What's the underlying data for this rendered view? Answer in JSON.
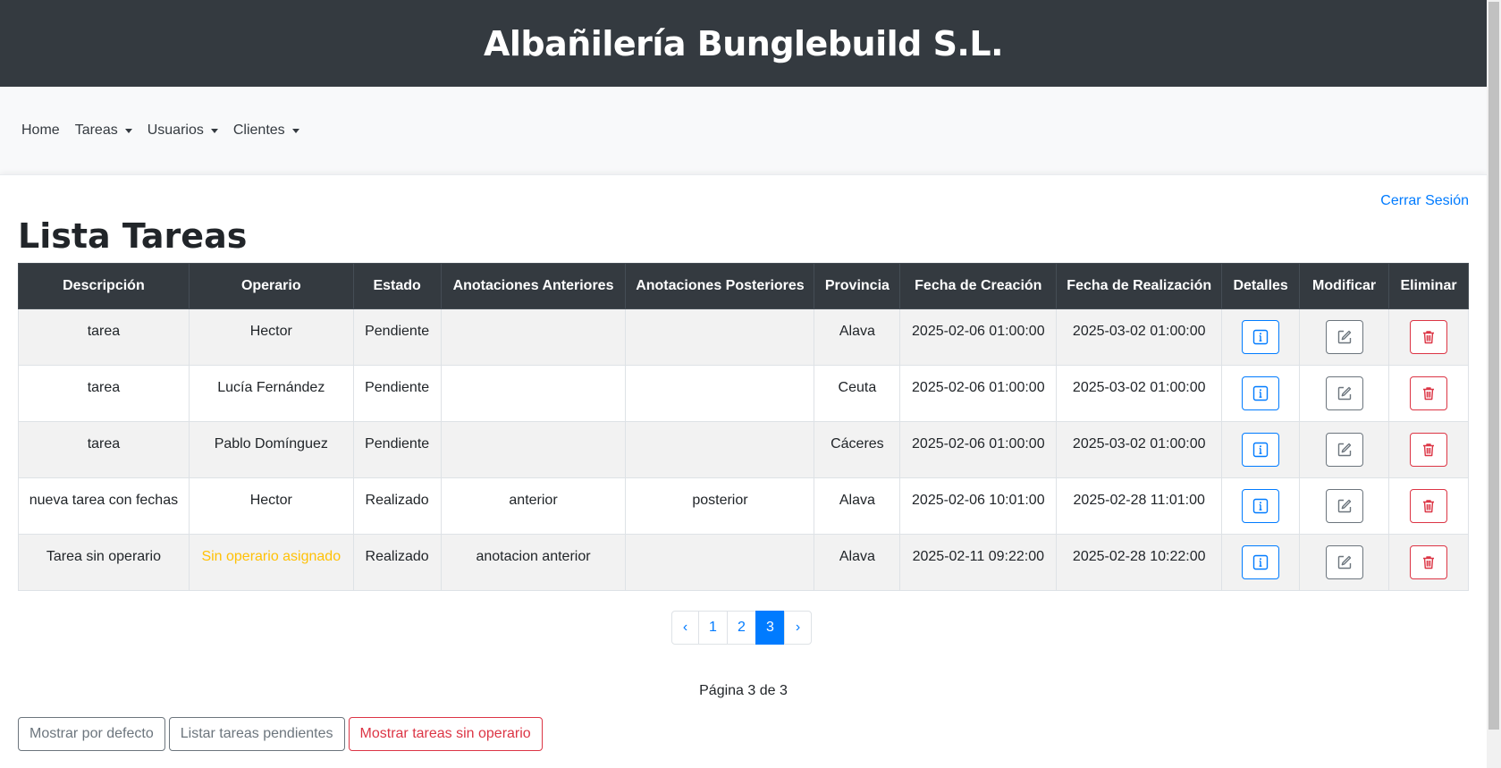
{
  "header": {
    "title": "Albañilería Bunglebuild S.L."
  },
  "nav": [
    {
      "label": "Home",
      "dropdown": false
    },
    {
      "label": "Tareas",
      "dropdown": true
    },
    {
      "label": "Usuarios",
      "dropdown": true
    },
    {
      "label": "Clientes",
      "dropdown": true
    }
  ],
  "logout": "Cerrar Sesión",
  "page_title": "Lista Tareas",
  "table": {
    "headers": [
      "Descripción",
      "Operario",
      "Estado",
      "Anotaciones Anteriores",
      "Anotaciones Posteriores",
      "Provincia",
      "Fecha de Creación",
      "Fecha de Realización",
      "Detalles",
      "Modificar",
      "Eliminar"
    ],
    "rows": [
      {
        "descripcion": "tarea",
        "operario": "Hector",
        "estado": "Pendiente",
        "anteriores": "",
        "posteriores": "",
        "provincia": "Alava",
        "creacion": "2025-02-06 01:00:00",
        "realizacion": "2025-03-02 01:00:00"
      },
      {
        "descripcion": "tarea",
        "operario": "Lucía Fernández",
        "estado": "Pendiente",
        "anteriores": "",
        "posteriores": "",
        "provincia": "Ceuta",
        "creacion": "2025-02-06 01:00:00",
        "realizacion": "2025-03-02 01:00:00"
      },
      {
        "descripcion": "tarea",
        "operario": "Pablo Domínguez",
        "estado": "Pendiente",
        "anteriores": "",
        "posteriores": "",
        "provincia": "Cáceres",
        "creacion": "2025-02-06 01:00:00",
        "realizacion": "2025-03-02 01:00:00"
      },
      {
        "descripcion": "nueva tarea con fechas",
        "operario": "Hector",
        "estado": "Realizado",
        "anteriores": "anterior",
        "posteriores": "posterior",
        "provincia": "Alava",
        "creacion": "2025-02-06 10:01:00",
        "realizacion": "2025-02-28 11:01:00"
      },
      {
        "descripcion": "Tarea sin operario",
        "operario": "Sin operario asignado",
        "operario_unassigned": true,
        "estado": "Realizado",
        "anteriores": "anotacion anterior",
        "posteriores": "",
        "provincia": "Alava",
        "creacion": "2025-02-11 09:22:00",
        "realizacion": "2025-02-28 10:22:00"
      }
    ]
  },
  "pagination": {
    "prev": "‹",
    "pages": [
      "1",
      "2",
      "3"
    ],
    "current": "3",
    "next": "›"
  },
  "page_info": "Página 3 de 3",
  "buttons": {
    "default": "Mostrar por defecto",
    "pending": "Listar tareas pendientes",
    "no_operator": "Mostrar tareas sin operario"
  },
  "icons": {
    "details": "info-icon",
    "modify": "edit-icon",
    "delete": "trash-icon"
  },
  "colors": {
    "primary": "#007bff",
    "secondary": "#6c757d",
    "danger": "#dc3545",
    "warning": "#ffc107",
    "dark": "#343a40"
  }
}
